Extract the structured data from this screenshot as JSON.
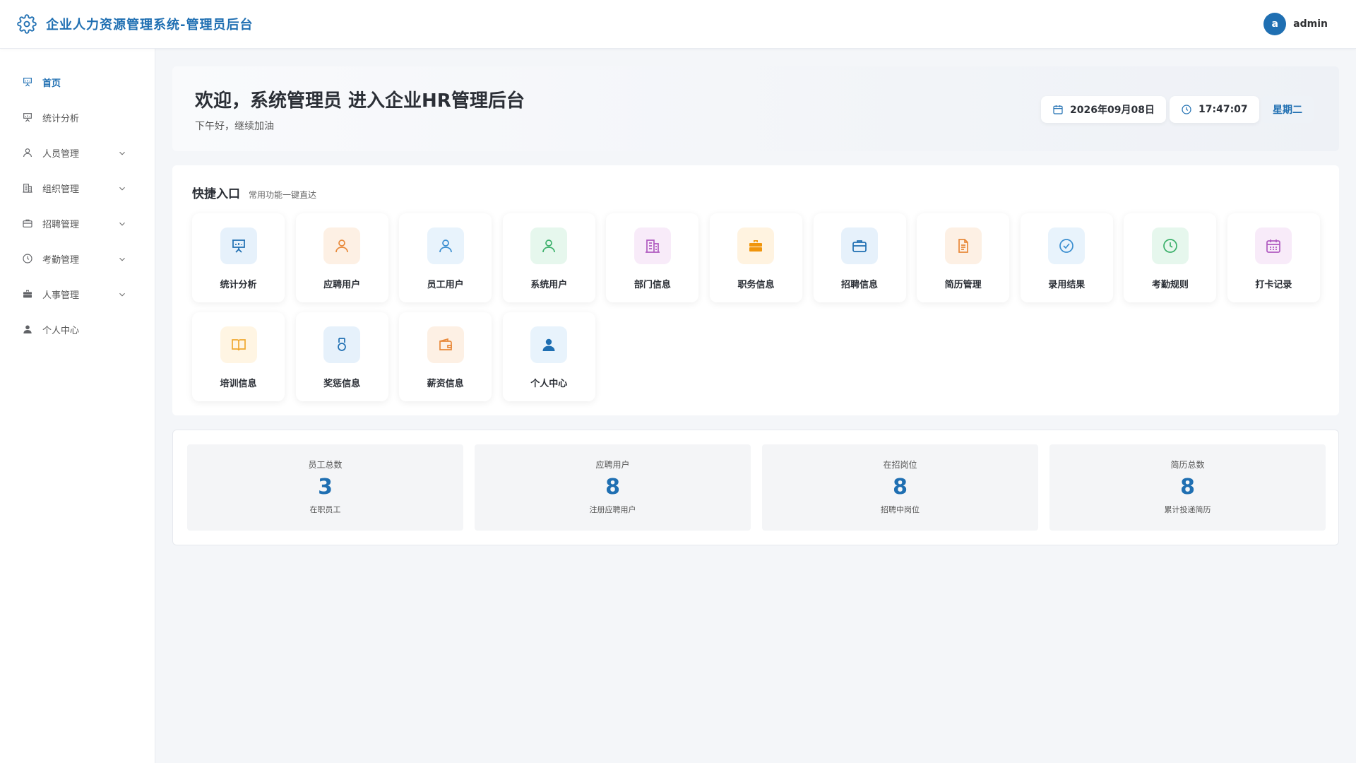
{
  "header": {
    "title": "企业人力资源管理系统-管理员后台",
    "avatar_letter": "a",
    "username": "admin"
  },
  "sidebar": {
    "items": [
      {
        "label": "首页",
        "icon": "presentation-icon",
        "active": true,
        "expandable": false
      },
      {
        "label": "统计分析",
        "icon": "presentation-icon",
        "active": false,
        "expandable": false
      },
      {
        "label": "人员管理",
        "icon": "user-icon",
        "active": false,
        "expandable": true
      },
      {
        "label": "组织管理",
        "icon": "building-icon",
        "active": false,
        "expandable": true
      },
      {
        "label": "招聘管理",
        "icon": "briefcase-icon",
        "active": false,
        "expandable": true
      },
      {
        "label": "考勤管理",
        "icon": "clock-icon",
        "active": false,
        "expandable": true
      },
      {
        "label": "人事管理",
        "icon": "toolbox-icon",
        "active": false,
        "expandable": true
      },
      {
        "label": "个人中心",
        "icon": "user-filled-icon",
        "active": false,
        "expandable": false
      }
    ]
  },
  "welcome": {
    "title": "欢迎，系统管理员 进入企业HR管理后台",
    "subtitle": "下午好，继续加油",
    "date": "2026年09月08日",
    "time": "17:47:07",
    "weekday": "星期二"
  },
  "quick": {
    "title": "快捷入口",
    "subtitle": "常用功能一键直达",
    "items": [
      {
        "label": "统计分析",
        "icon": "presentation-icon",
        "color": "#1f6fb2",
        "bg": "#e6f1fb"
      },
      {
        "label": "应聘用户",
        "icon": "user-icon",
        "color": "#e8893a",
        "bg": "#fdf0e4"
      },
      {
        "label": "员工用户",
        "icon": "user-icon",
        "color": "#3a8ed0",
        "bg": "#e8f3fc"
      },
      {
        "label": "系统用户",
        "icon": "user-icon",
        "color": "#3bb06a",
        "bg": "#e6f7ed"
      },
      {
        "label": "部门信息",
        "icon": "building-icon",
        "color": "#b05ac0",
        "bg": "#f8ebf9"
      },
      {
        "label": "职务信息",
        "icon": "toolbox-icon",
        "color": "#f0950c",
        "bg": "#fff3e0"
      },
      {
        "label": "招聘信息",
        "icon": "briefcase-icon",
        "color": "#1f6fb2",
        "bg": "#e6f1fb"
      },
      {
        "label": "简历管理",
        "icon": "document-icon",
        "color": "#e8893a",
        "bg": "#fdf0e4"
      },
      {
        "label": "录用结果",
        "icon": "check-circle-icon",
        "color": "#3a8ed0",
        "bg": "#e8f3fc"
      },
      {
        "label": "考勤规则",
        "icon": "clock-icon",
        "color": "#3bb06a",
        "bg": "#e6f7ed"
      },
      {
        "label": "打卡记录",
        "icon": "calendar-icon",
        "color": "#b05ac0",
        "bg": "#f8ebf9"
      },
      {
        "label": "培训信息",
        "icon": "book-icon",
        "color": "#f0a830",
        "bg": "#fff5e3"
      },
      {
        "label": "奖惩信息",
        "icon": "medal-icon",
        "color": "#1f6fb2",
        "bg": "#e6f1fb"
      },
      {
        "label": "薪资信息",
        "icon": "wallet-icon",
        "color": "#e8893a",
        "bg": "#fdf0e4"
      },
      {
        "label": "个人中心",
        "icon": "user-filled-icon",
        "color": "#1f6fb2",
        "bg": "#e8f3fc"
      }
    ]
  },
  "stats": [
    {
      "label": "员工总数",
      "value": "3",
      "note": "在职员工"
    },
    {
      "label": "应聘用户",
      "value": "8",
      "note": "注册应聘用户"
    },
    {
      "label": "在招岗位",
      "value": "8",
      "note": "招聘中岗位"
    },
    {
      "label": "简历总数",
      "value": "8",
      "note": "累计投递简历"
    }
  ],
  "colors": {
    "primary": "#1f6fb2",
    "background": "#f4f6f9"
  }
}
